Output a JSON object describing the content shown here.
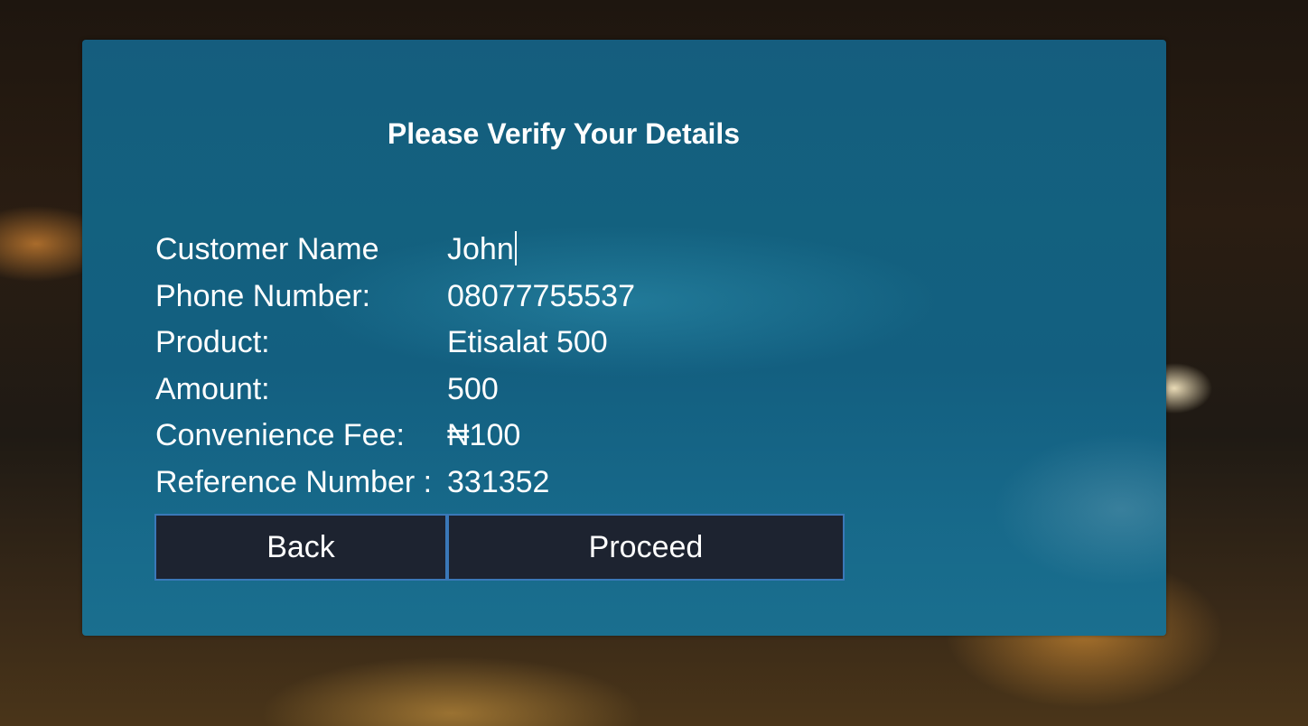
{
  "form": {
    "title": "Please Verify Your Details",
    "fields": [
      {
        "label": "Customer Name",
        "value": "John"
      },
      {
        "label": "Phone Number:",
        "value": "08077755537"
      },
      {
        "label": "Product:",
        "value": "Etisalat 500"
      },
      {
        "label": "Amount:",
        "value": "500"
      },
      {
        "label": "Convenience Fee:",
        "value": "₦100"
      },
      {
        "label": "Reference Number :",
        "value": "331352"
      }
    ],
    "back_label": "Back",
    "proceed_label": "Proceed"
  },
  "colors": {
    "panel": "#13617f",
    "button_bg": "#1d2330",
    "button_border": "#3a78b8",
    "text": "#ffffff"
  }
}
